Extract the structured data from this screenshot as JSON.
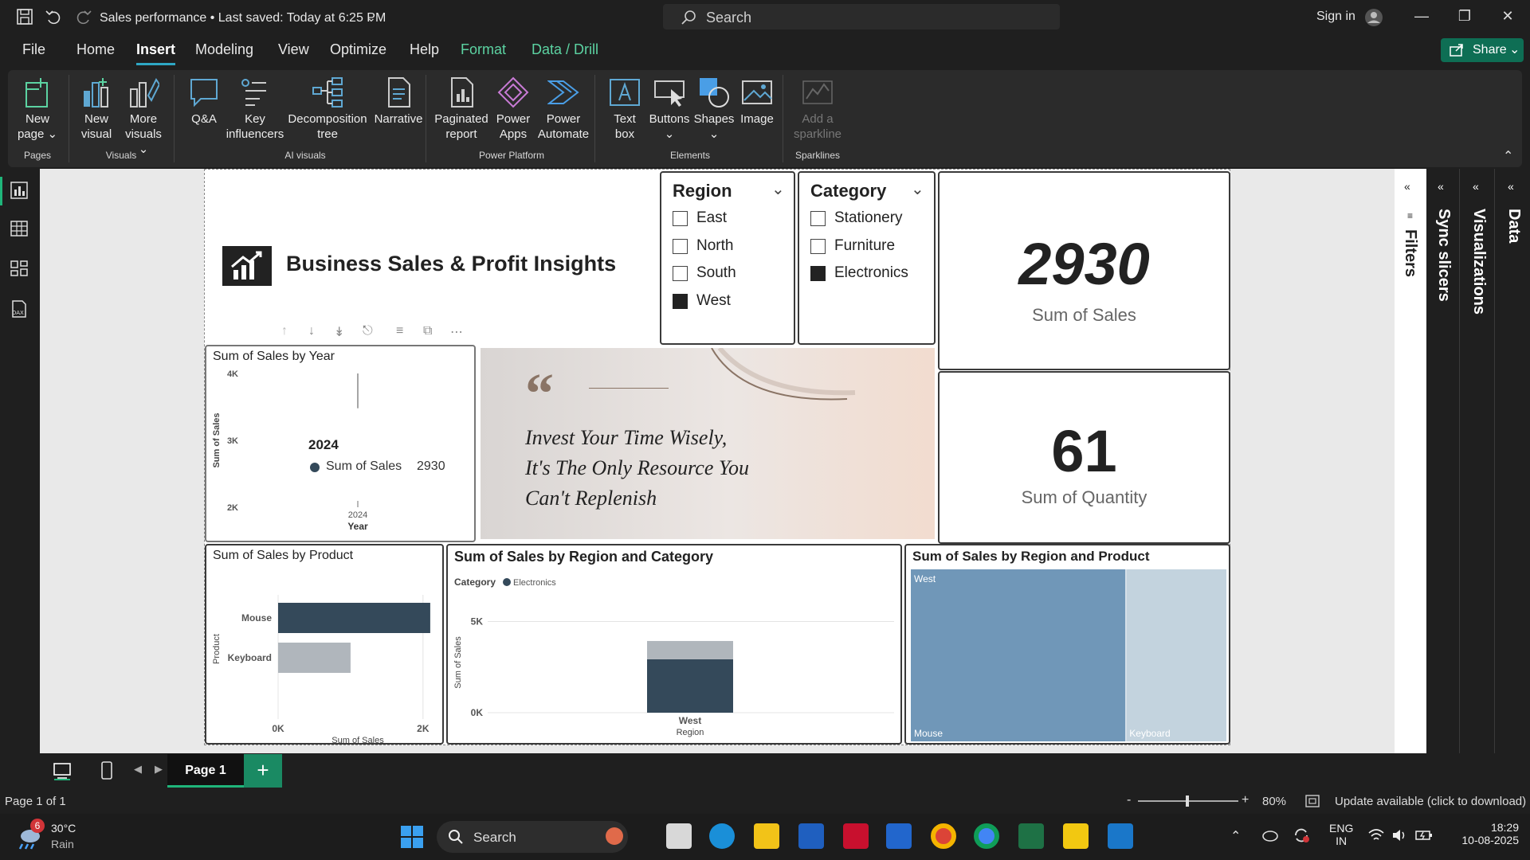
{
  "titlebar": {
    "doc_title": "Sales performance • Last saved: Today at 6:25 PM",
    "search_placeholder": "Search",
    "sign_in": "Sign in"
  },
  "menu": {
    "items": [
      "File",
      "Home",
      "Insert",
      "Modeling",
      "View",
      "Optimize",
      "Help",
      "Format",
      "Data / Drill"
    ],
    "active": "Insert",
    "share": "Share"
  },
  "ribbon": {
    "buttons": {
      "new_page": [
        "New",
        "page ⌄"
      ],
      "new_visual": [
        "New",
        "visual"
      ],
      "more_visuals": [
        "More",
        "visuals ⌄"
      ],
      "qa": [
        "Q&A"
      ],
      "key_influencers": [
        "Key",
        "influencers"
      ],
      "decomposition_tree": [
        "Decomposition",
        "tree"
      ],
      "narrative": [
        "Narrative"
      ],
      "paginated_report": [
        "Paginated",
        "report"
      ],
      "power_apps": [
        "Power",
        "Apps"
      ],
      "power_automate": [
        "Power",
        "Automate"
      ],
      "text_box": [
        "Text",
        "box"
      ],
      "buttons": [
        "Buttons",
        "⌄"
      ],
      "shapes": [
        "Shapes",
        "⌄"
      ],
      "image": [
        "Image"
      ],
      "add_sparkline": [
        "Add a",
        "sparkline"
      ]
    },
    "groups": {
      "pages": "Pages",
      "visuals": "Visuals",
      "ai_visuals": "AI visuals",
      "power_platform": "Power Platform",
      "elements": "Elements",
      "sparklines": "Sparklines"
    }
  },
  "report": {
    "title": "Business Sales & Profit Insights",
    "region_slicer": {
      "title": "Region",
      "items": [
        {
          "label": "East",
          "checked": false
        },
        {
          "label": "North",
          "checked": false
        },
        {
          "label": "South",
          "checked": false
        },
        {
          "label": "West",
          "checked": true
        }
      ]
    },
    "category_slicer": {
      "title": "Category",
      "items": [
        {
          "label": "Stationery",
          "checked": false
        },
        {
          "label": "Furniture",
          "checked": false
        },
        {
          "label": "Electronics",
          "checked": true
        }
      ]
    },
    "kpi_sales": {
      "value": "2930",
      "label": "Sum of Sales"
    },
    "kpi_quantity": {
      "value": "61",
      "label": "Sum of Quantity"
    },
    "quote": {
      "lines": [
        "Invest Your Time Wisely,",
        "It's The Only Resource You",
        "Can't Replenish"
      ]
    },
    "tooltip": {
      "year": "2024",
      "series": "Sum of Sales",
      "value": "2930"
    }
  },
  "chart_data": [
    {
      "type": "bar",
      "title": "Sum of Sales by Year",
      "xlabel": "Year",
      "ylabel": "Sum of Sales",
      "categories": [
        "2024"
      ],
      "values": [
        2930
      ],
      "ylim": [
        2000,
        4000
      ],
      "yticks": [
        "4K",
        "3K",
        "2K"
      ]
    },
    {
      "type": "bar",
      "orientation": "horizontal",
      "title": "Sum of Sales by Product",
      "xlabel": "Sum of Sales",
      "ylabel": "Product",
      "categories": [
        "Mouse",
        "Keyboard"
      ],
      "values": [
        2100,
        1000
      ],
      "xlim": [
        0,
        2200
      ],
      "xticks": [
        "0K",
        "2K"
      ],
      "colors": [
        "#34495a",
        "#b0b6bc"
      ]
    },
    {
      "type": "bar",
      "stacked": true,
      "title": "Sum of Sales by Region and Category",
      "xlabel": "Region",
      "ylabel": "Sum of Sales",
      "legend_title": "Category",
      "legend": [
        "Electronics"
      ],
      "categories": [
        "West"
      ],
      "series": [
        {
          "values": [
            2930
          ],
          "color": "#34495a"
        },
        {
          "values": [
            1000
          ],
          "color": "#b0b6bc"
        }
      ],
      "ylim": [
        0,
        5500
      ],
      "yticks": [
        "5K",
        "0K"
      ]
    },
    {
      "type": "heatmap",
      "subtype": "treemap",
      "title": "Sum of Sales by Region and Product",
      "group": "West",
      "items": [
        {
          "label": "Mouse",
          "value": 2000,
          "color": "#7097b8"
        },
        {
          "label": "Keyboard",
          "value": 930,
          "color": "#c3d3de"
        }
      ]
    }
  ],
  "panes": {
    "filters": "Filters",
    "sync_slicers": "Sync slicers",
    "visualizations": "Visualizations",
    "data": "Data"
  },
  "tabs": {
    "page1": "Page 1",
    "add": "+"
  },
  "status": {
    "page_info": "Page 1 of 1",
    "zoom_minus": "-",
    "zoom_plus": "+",
    "zoom": "80%",
    "zoom_level": 0.8,
    "update": "Update available (click to download)"
  },
  "taskbar": {
    "weather_temp": "30°C",
    "weather_desc": "Rain",
    "weather_badge": "6",
    "search": "Search",
    "lang1": "ENG",
    "lang2": "IN",
    "time": "18:29",
    "date": "10-08-2025"
  }
}
